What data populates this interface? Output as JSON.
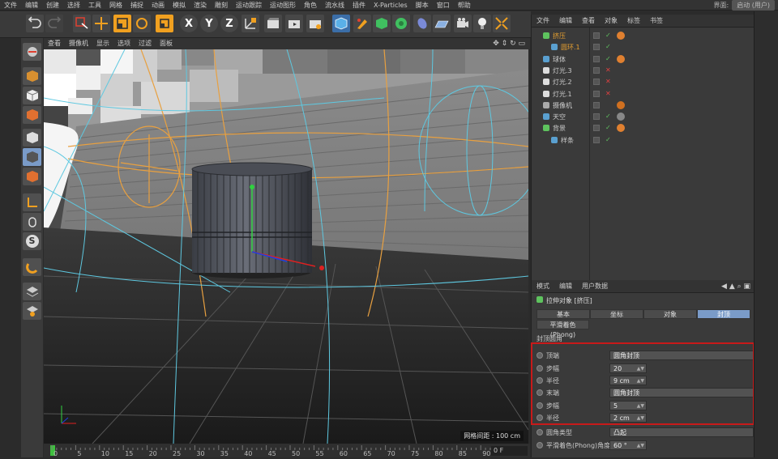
{
  "menubar": {
    "items": [
      "文件",
      "编辑",
      "创建",
      "选择",
      "工具",
      "网格",
      "捕捉",
      "动画",
      "模拟",
      "渲染",
      "雕刻",
      "运动跟踪",
      "运动图形",
      "角色",
      "流水线",
      "插件",
      "X-Particles",
      "脚本",
      "窗口",
      "帮助"
    ],
    "interface_label": "界面:",
    "interface_value": "启动 (用户)"
  },
  "toolbar": {
    "icons": [
      "undo-icon",
      "redo-icon",
      "live-select-icon",
      "move-icon",
      "scale-icon",
      "rotate-icon",
      "recent-tool-icon",
      "x-axis-icon",
      "y-axis-icon",
      "z-axis-icon",
      "world-coord-icon",
      "render-view-icon",
      "render-picture-icon",
      "render-settings-icon",
      "cube-icon",
      "pen-icon",
      "subdivision-icon",
      "cloner-icon",
      "deformer-icon",
      "floor-icon",
      "camera-icon",
      "light-icon",
      "render-region-icon"
    ],
    "axis_x": "X",
    "axis_y": "Y",
    "axis_z": "Z"
  },
  "left_tools": {
    "icons": [
      "model-mode-icon",
      "texture-mode-icon",
      "workplane-icon",
      "points-mode-icon",
      "edges-mode-icon",
      "polygons-mode-icon",
      "axis-mode-icon",
      "tweak-mode-icon",
      "solo-icon",
      "snap-icon",
      "grid-snap-icon",
      "layer-icon"
    ],
    "solo_label": "S"
  },
  "viewport": {
    "menu": [
      "查看",
      "摄像机",
      "显示",
      "选项",
      "过滤",
      "面板"
    ],
    "grid_label": "网格间距 : 100 cm"
  },
  "timeline": {
    "ticks": [
      "0",
      "5",
      "10",
      "15",
      "20",
      "25",
      "30",
      "35",
      "40",
      "45",
      "50",
      "55",
      "60",
      "65",
      "70",
      "75",
      "80",
      "85",
      "90"
    ],
    "frame_value": "0 F"
  },
  "object_manager": {
    "menu": [
      "文件",
      "编辑",
      "查看",
      "对象",
      "标签",
      "书签"
    ],
    "rows": [
      {
        "name": "挤压",
        "indent": 0,
        "highlight": true,
        "icon_color": "#5ec35e",
        "check": "g"
      },
      {
        "name": "圆环.1",
        "indent": 1,
        "highlight": true,
        "icon_color": "#5aa0d0",
        "check": "g"
      },
      {
        "name": "球体",
        "indent": 0,
        "highlight": false,
        "icon_color": "#5aa0d0",
        "check": "g"
      },
      {
        "name": "灯光.3",
        "indent": 0,
        "highlight": false,
        "icon_color": "#dddddd",
        "check": "r"
      },
      {
        "name": "灯光.2",
        "indent": 0,
        "highlight": false,
        "icon_color": "#dddddd",
        "check": "r"
      },
      {
        "name": "灯光.1",
        "indent": 0,
        "highlight": false,
        "icon_color": "#dddddd",
        "check": "r"
      },
      {
        "name": "摄像机",
        "indent": 0,
        "highlight": false,
        "icon_color": "#aaaaaa",
        "check": "x"
      },
      {
        "name": "天空",
        "indent": 0,
        "highlight": false,
        "icon_color": "#5aa0d0",
        "check": "g"
      },
      {
        "name": "背景",
        "indent": 0,
        "highlight": false,
        "icon_color": "#5ec35e",
        "check": "g"
      },
      {
        "name": "样条",
        "indent": 1,
        "highlight": false,
        "icon_color": "#5aa0d0",
        "check": "g"
      }
    ]
  },
  "attribute_manager": {
    "menu": [
      "模式",
      "编辑",
      "用户数据"
    ],
    "object_title": "拉伸对象 [挤压]",
    "tabs": [
      "基本",
      "坐标",
      "对象",
      "封顶"
    ],
    "active_tab": "封顶",
    "phong_tab": "平滑着色(Phong)",
    "section_title": "封顶圆角",
    "params": [
      {
        "label": "顶端",
        "value": "圆角封顶",
        "kind": "wide"
      },
      {
        "label": "步幅",
        "value": "20",
        "kind": "num"
      },
      {
        "label": "半径",
        "value": "9 cm",
        "kind": "num"
      },
      {
        "label": "末端",
        "value": "圆角封顶",
        "kind": "wide"
      },
      {
        "label": "步幅",
        "value": "5",
        "kind": "num"
      },
      {
        "label": "半径",
        "value": "2 cm",
        "kind": "num"
      },
      {
        "label": "圆角类型",
        "value": "凸起",
        "kind": "wide"
      },
      {
        "label": "平滑着色(Phong)角度",
        "value": "60 °",
        "kind": "num"
      }
    ]
  },
  "colors": {
    "accent_orange": "#f0a020",
    "active_tab_blue": "#7a9bc8",
    "highlight_red": "#c81a1a"
  }
}
